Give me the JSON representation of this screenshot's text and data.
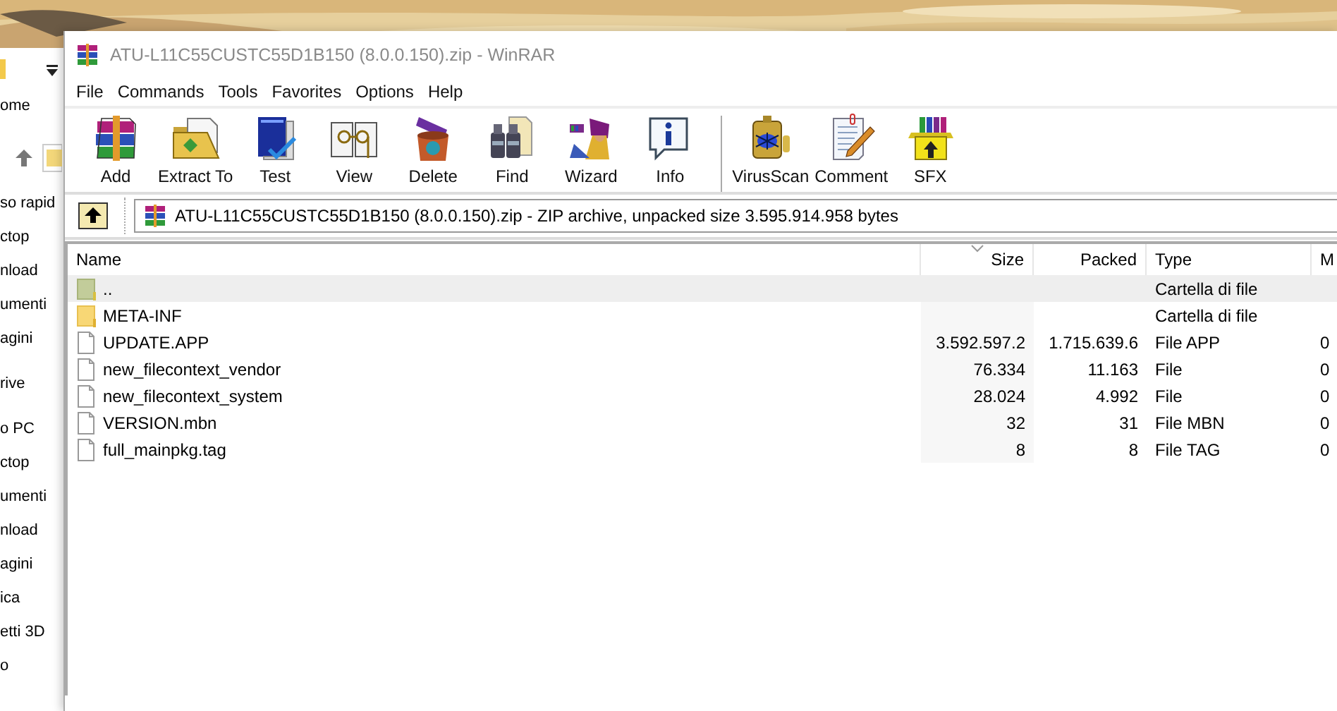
{
  "explorer": {
    "ribbon_tab": "ome",
    "sidebar_groups": [
      [
        "so rapid",
        "ctop",
        "nload",
        "umenti",
        "agini"
      ],
      [
        "rive"
      ],
      [
        "o PC",
        "ctop",
        "umenti",
        "nload",
        "agini",
        "ica",
        "etti 3D",
        "o"
      ]
    ]
  },
  "window": {
    "title": "ATU-L11C55CUSTC55D1B150 (8.0.0.150).zip - WinRAR"
  },
  "menu": [
    "File",
    "Commands",
    "Tools",
    "Favorites",
    "Options",
    "Help"
  ],
  "toolbar": {
    "groups": [
      [
        "Add",
        "Extract To",
        "Test",
        "View",
        "Delete",
        "Find",
        "Wizard",
        "Info"
      ],
      [
        "VirusScan",
        "Comment",
        "SFX"
      ]
    ]
  },
  "address": {
    "text": "ATU-L11C55CUSTC55D1B150 (8.0.0.150).zip - ZIP archive, unpacked size 3.595.914.958 bytes"
  },
  "table": {
    "columns": [
      {
        "label": "Name",
        "sorted": false
      },
      {
        "label": "Size",
        "sorted": true
      },
      {
        "label": "Packed",
        "sorted": false
      },
      {
        "label": "Type",
        "sorted": false
      },
      {
        "label": "M",
        "sorted": false
      }
    ],
    "rows": [
      {
        "kind": "parent",
        "selected": true,
        "cells": [
          "..",
          "",
          "",
          "Cartella di file",
          ""
        ]
      },
      {
        "kind": "folder",
        "selected": false,
        "cells": [
          "META-INF",
          "",
          "",
          "Cartella di file",
          ""
        ]
      },
      {
        "kind": "file",
        "selected": false,
        "cells": [
          "UPDATE.APP",
          "3.592.597.2",
          "1.715.639.6",
          "File APP",
          "0"
        ]
      },
      {
        "kind": "file",
        "selected": false,
        "cells": [
          "new_filecontext_vendor",
          "76.334",
          "11.163",
          "File",
          "0"
        ]
      },
      {
        "kind": "file",
        "selected": false,
        "cells": [
          "new_filecontext_system",
          "28.024",
          "4.992",
          "File",
          "0"
        ]
      },
      {
        "kind": "file",
        "selected": false,
        "cells": [
          "VERSION.mbn",
          "32",
          "31",
          "File MBN",
          "0"
        ]
      },
      {
        "kind": "file",
        "selected": false,
        "cells": [
          "full_mainpkg.tag",
          "8",
          "8",
          "File TAG",
          "0"
        ]
      }
    ]
  }
}
